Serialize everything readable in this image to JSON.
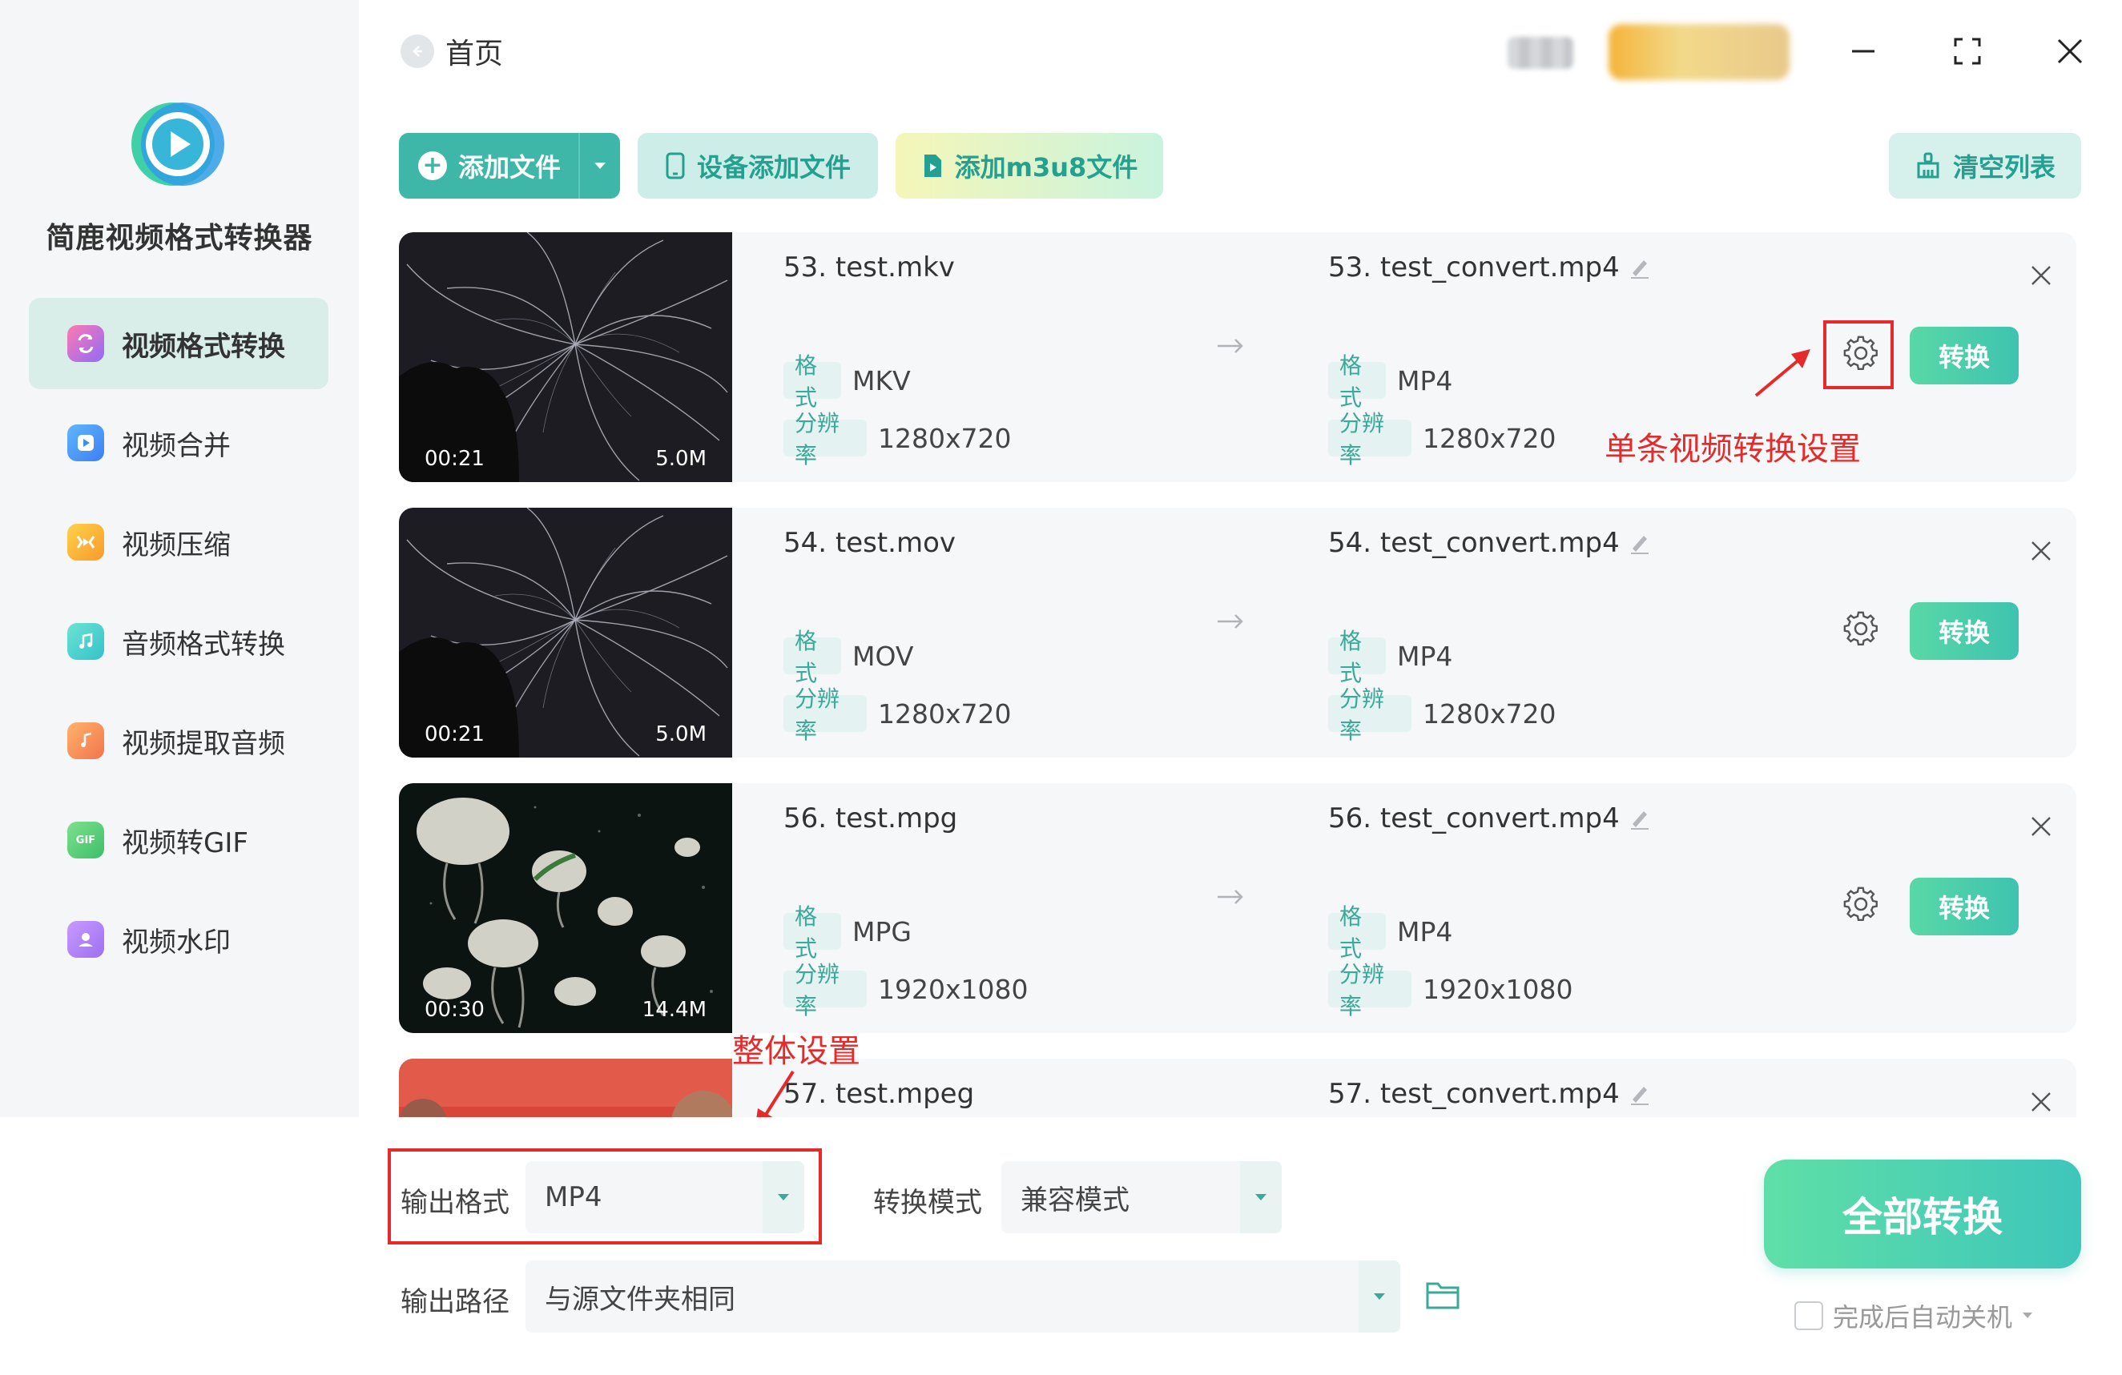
{
  "app": {
    "title": "简鹿视频格式转换器",
    "accent_color": "#3fb7a8"
  },
  "sidebar": {
    "items": [
      {
        "label": "视频格式转换",
        "icon": "video-convert-icon",
        "active": true,
        "color": "#a26cf3"
      },
      {
        "label": "视频合并",
        "icon": "video-merge-icon",
        "active": false,
        "color": "#4a9bf4"
      },
      {
        "label": "视频压缩",
        "icon": "video-compress-icon",
        "active": false,
        "color": "#f7a93a"
      },
      {
        "label": "音频格式转换",
        "icon": "audio-convert-icon",
        "active": false,
        "color": "#3fd3c1"
      },
      {
        "label": "视频提取音频",
        "icon": "extract-audio-icon",
        "active": false,
        "color": "#f48f4c"
      },
      {
        "label": "视频转GIF",
        "icon": "gif-icon",
        "active": false,
        "color": "#4ccf7a"
      },
      {
        "label": "视频水印",
        "icon": "watermark-icon",
        "active": false,
        "color": "#b77cf5"
      }
    ]
  },
  "header": {
    "home_label": "首页"
  },
  "toolbar": {
    "add_file": "添加文件",
    "add_device": "设备添加文件",
    "add_m3u8": "添加m3u8文件",
    "clear_list": "清空列表"
  },
  "files": [
    {
      "src_name": "53. test.mkv",
      "dst_name": "53. test_convert.mp4",
      "duration": "00:21",
      "size": "5.0M",
      "src_format": "MKV",
      "src_res": "1280x720",
      "dst_format": "MP4",
      "dst_res": "1280x720",
      "thumb": "stars"
    },
    {
      "src_name": "54. test.mov",
      "dst_name": "54. test_convert.mp4",
      "duration": "00:21",
      "size": "5.0M",
      "src_format": "MOV",
      "src_res": "1280x720",
      "dst_format": "MP4",
      "dst_res": "1280x720",
      "thumb": "stars"
    },
    {
      "src_name": "56. test.mpg",
      "dst_name": "56. test_convert.mp4",
      "duration": "00:30",
      "size": "14.4M",
      "src_format": "MPG",
      "src_res": "1920x1080",
      "dst_format": "MP4",
      "dst_res": "1920x1080",
      "thumb": "jellyfish"
    },
    {
      "src_name": "57. test.mpeg",
      "dst_name": "57. test_convert.mp4",
      "thumb": "red"
    }
  ],
  "labels": {
    "format": "格式",
    "resolution": "分辨率",
    "convert": "转换"
  },
  "settings": {
    "output_format_label": "输出格式",
    "output_format_value": "MP4",
    "mode_label": "转换模式",
    "mode_value": "兼容模式",
    "output_path_label": "输出路径",
    "output_path_value": "与源文件夹相同",
    "convert_all": "全部转换",
    "shutdown_label": "完成后自动关机"
  },
  "annotations": {
    "single_settings": "单条视频转换设置",
    "global_settings": "整体设置",
    "color": "#e62a2a"
  }
}
